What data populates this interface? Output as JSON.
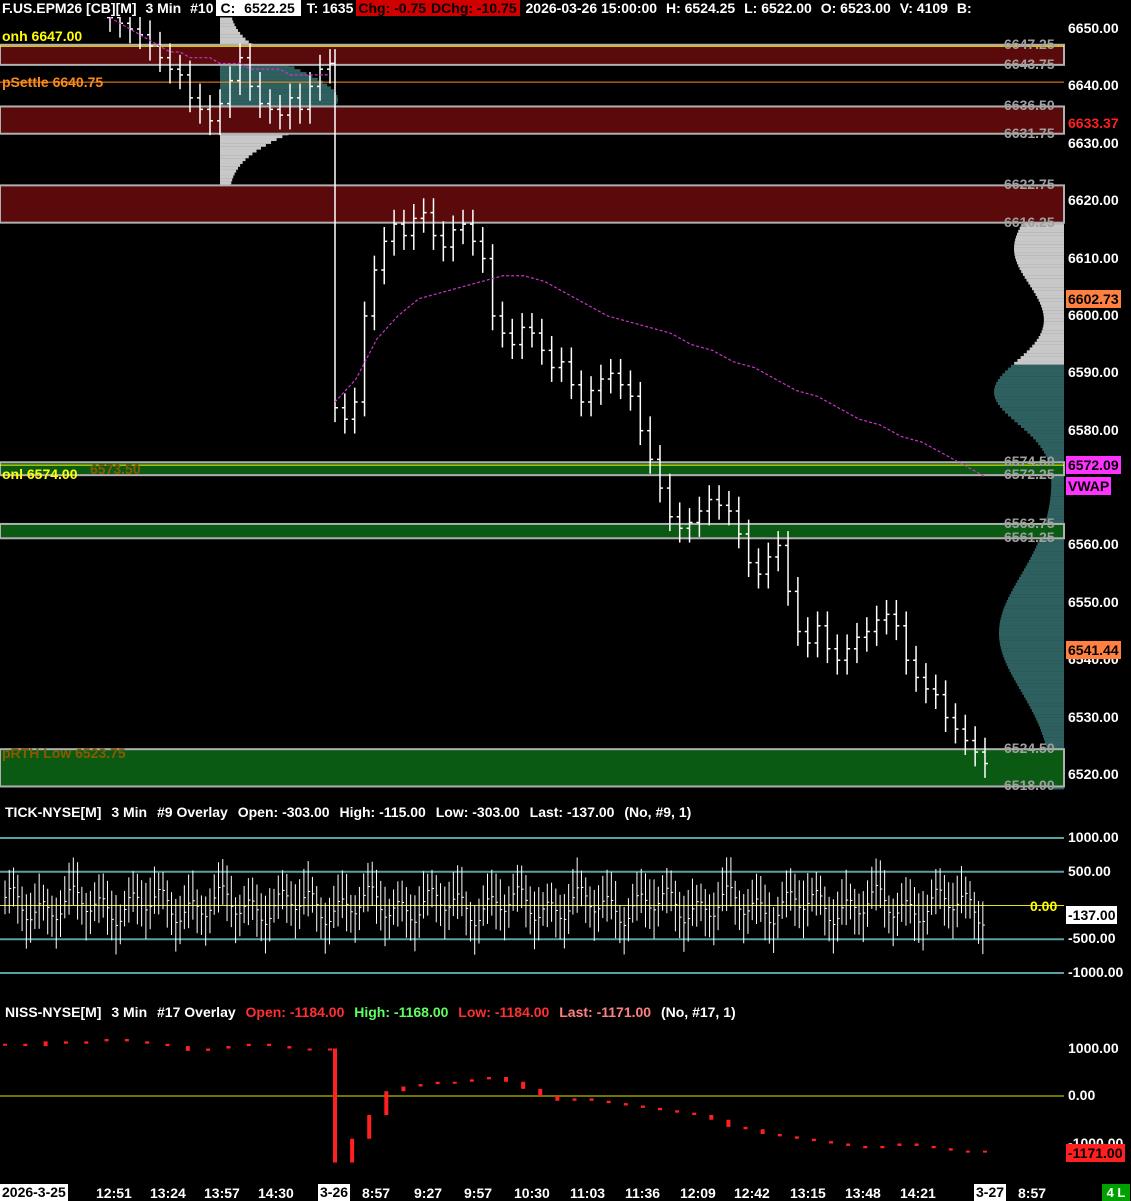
{
  "header": {
    "symbol": "F.US.EPM26 [CB][M]",
    "interval": "3 Min",
    "chart_num": "#10",
    "close_label": "C:",
    "close_value": "6522.25",
    "trades": "T: 1635",
    "chg": "Chg: -0.75",
    "dchg": "DChg: -10.75",
    "datetime": "2026-03-26 15:00:00",
    "high": "H: 6524.25",
    "low": "L: 6522.00",
    "open": "O: 6523.00",
    "volume": "V: 4109",
    "trailing": "B:"
  },
  "tick_panel": {
    "name": "TICK-NYSE[M]",
    "interval": "3 Min",
    "chart_num": "#9 Overlay",
    "open": "Open: -303.00",
    "high": "High: -115.00",
    "low": "Low: -303.00",
    "last": "Last: -137.00",
    "extra": "(No, #9, 1)",
    "zero_label": "0.00",
    "last_tag": "-137.00",
    "axis": [
      "1000.00",
      "500.00",
      "-500.00",
      "-1000.00"
    ]
  },
  "niss_panel": {
    "name": "NISS-NYSE[M]",
    "interval": "3 Min",
    "chart_num": "#17 Overlay",
    "open": "Open: -1184.00",
    "high": "High: -1168.00",
    "low": "Low: -1184.00",
    "last": "Last: -1171.00",
    "extra": "(No, #17, 1)",
    "last_tag": "-1171.00",
    "axis": [
      "1000.00",
      "0.00",
      "-1000.00"
    ]
  },
  "price_axis": [
    "6650.00",
    "6640.00",
    "6630.00",
    "6620.00",
    "6610.00",
    "6600.00",
    "6590.00",
    "6580.00",
    "6560.00",
    "6550.00",
    "6540.00",
    "6530.00",
    "6520.00"
  ],
  "level_labels": {
    "onh": "onh 6647.00",
    "psettle": "pSettle 6640.75",
    "onl": "onl 6574.00",
    "onl_ghost": "6573.50",
    "prth_low": "pRTH Low 6523.75",
    "right_levels": [
      "6647.25",
      "6643.75",
      "6636.50",
      "6631.75",
      "6622.75",
      "6616.25",
      "6574.50",
      "6572.25",
      "6563.75",
      "6561.25",
      "6524.50",
      "6518.00"
    ]
  },
  "price_tags": {
    "red": "6633.37",
    "orange1": "6602.73",
    "vwap_price": "6572.09",
    "vwap_label": "VWAP",
    "orange2": "6541.44"
  },
  "time_axis": {
    "start": "2026-3-25",
    "labels": [
      "12:51",
      "13:24",
      "13:57",
      "14:30"
    ],
    "day_marker": "3-26",
    "labels2": [
      "8:57",
      "9:27",
      "9:57",
      "10:30",
      "11:03",
      "11:36",
      "12:09",
      "12:42",
      "13:15",
      "13:48",
      "14:21"
    ],
    "end_marker": "3-27",
    "end_label": "8:57",
    "status": "4 L"
  },
  "colors": {
    "background": "#000000",
    "bar": "#ffffff",
    "vwap": "#cc33cc",
    "resistance_zone": "#5a0a0a",
    "support_zone": "#0b5a14",
    "profile": "#c8c8c8",
    "profile_teal": "#2f6060",
    "niss": "#ff2020",
    "zero_line": "#e6e600"
  },
  "chart_data": [
    {
      "type": "candlestick",
      "title": "F.US.EPM26 3 Min",
      "ylim": [
        6515,
        6654
      ],
      "zones": [
        {
          "kind": "resistance",
          "from": 6643.75,
          "to": 6647.25
        },
        {
          "kind": "resistance",
          "from": 6631.75,
          "to": 6636.5
        },
        {
          "kind": "resistance",
          "from": 6616.25,
          "to": 6622.75
        },
        {
          "kind": "support",
          "from": 6572.25,
          "to": 6574.5
        },
        {
          "kind": "support",
          "from": 6561.25,
          "to": 6563.75
        },
        {
          "kind": "support",
          "from": 6518.0,
          "to": 6524.5
        }
      ],
      "series": [
        {
          "name": "price",
          "values": [
            6652,
            6651,
            6650,
            6649,
            6647,
            6645,
            6643,
            6642,
            6638,
            6636,
            6634,
            6637,
            6641,
            6645,
            6640,
            6637,
            6636,
            6635,
            6638,
            6636,
            6640,
            6643,
            6644,
            6584,
            6582,
            6585,
            6600,
            6608,
            6613,
            6616,
            6614,
            6617,
            6618,
            6614,
            6612,
            6615,
            6616,
            6613,
            6610,
            6600,
            6597,
            6595,
            6598,
            6597,
            6594,
            6591,
            6592,
            6588,
            6585,
            6587,
            6589,
            6590,
            6588,
            6586,
            6580,
            6575,
            6570,
            6565,
            6563,
            6564,
            6566,
            6568,
            6567,
            6566,
            6562,
            6557,
            6555,
            6558,
            6560,
            6552,
            6545,
            6543,
            6546,
            6542,
            6540,
            6542,
            6544,
            6545,
            6547,
            6548,
            6546,
            6540,
            6537,
            6535,
            6534,
            6530,
            6528,
            6526,
            6524,
            6522
          ]
        },
        {
          "name": "VWAP",
          "values": [
            6652,
            6651,
            6650,
            6649,
            6648,
            6647,
            6646,
            6646,
            6645,
            6645,
            6645,
            6644,
            6644,
            6644,
            6643,
            6643,
            6643,
            6643,
            6642,
            6642,
            6642,
            6642,
            6642,
            6585,
            6589,
            6596,
            6600,
            6603,
            6604,
            6605,
            6606,
            6607,
            6607,
            6606,
            6604,
            6602,
            6600,
            6599,
            6598,
            6597,
            6595,
            6594,
            6592,
            6591,
            6589,
            6587,
            6586,
            6584,
            6582,
            6581,
            6579,
            6578,
            6576,
            6574,
            6572
          ]
        }
      ]
    },
    {
      "type": "bar",
      "title": "TICK-NYSE 3 Min",
      "ylim": [
        -1150,
        1100
      ],
      "reference_lines": [
        1000,
        500,
        0,
        -500,
        -1000
      ]
    },
    {
      "type": "line",
      "title": "NISS-NYSE 3 Min",
      "ylim": [
        -1300,
        1300
      ],
      "series": [
        {
          "name": "NISS",
          "values": [
            1100,
            1050,
            1150,
            1100,
            1150,
            1200,
            1150,
            1100,
            1050,
            950,
            1000,
            1050,
            1100,
            1050,
            1000,
            1000,
            1000,
            -1400,
            -900,
            -400,
            100,
            200,
            250,
            300,
            300,
            350,
            400,
            300,
            150,
            0,
            -100,
            -50,
            -100,
            -150,
            -200,
            -250,
            -300,
            -350,
            -400,
            -500,
            -650,
            -700,
            -800,
            -850,
            -900,
            -950,
            -1000,
            -1050,
            -1100,
            -1050,
            -1000,
            -1050,
            -1100,
            -1150,
            -1150,
            -1171
          ]
        }
      ]
    }
  ]
}
